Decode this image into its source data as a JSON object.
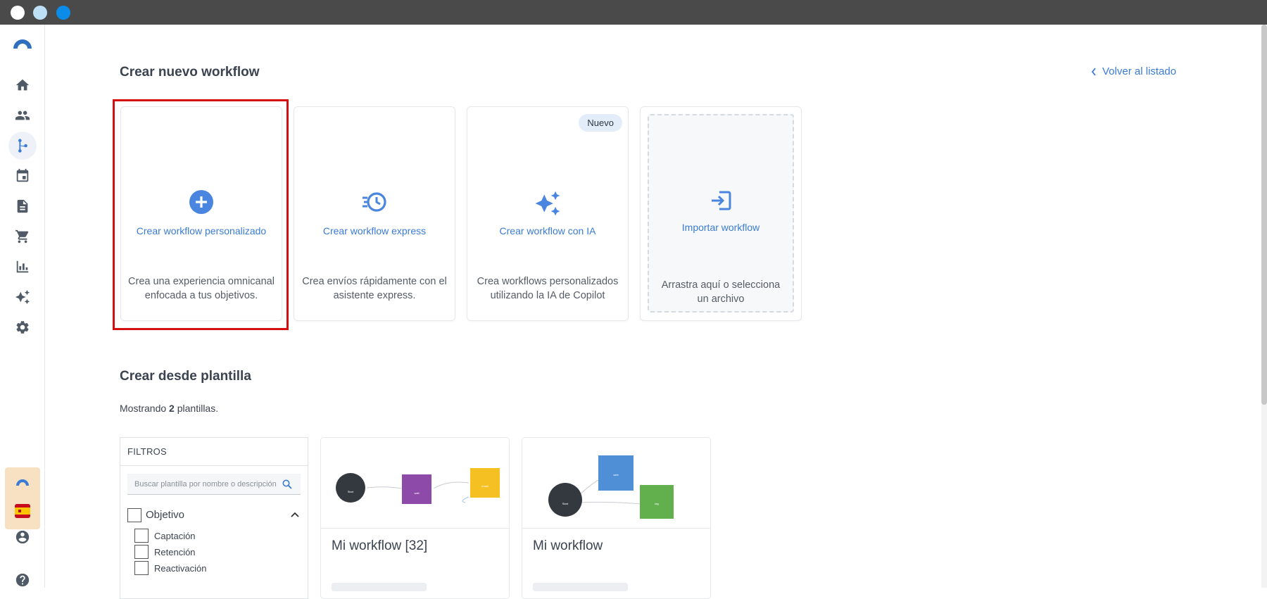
{
  "window": {
    "traffic_light_colors": [
      "#ffffff",
      "#bde0f7",
      "#0a8ce8"
    ]
  },
  "sidebar": {
    "items": [
      {
        "icon": "home-icon"
      },
      {
        "icon": "contacts-icon"
      },
      {
        "icon": "workflow-icon",
        "active": true
      },
      {
        "icon": "calendar-icon"
      },
      {
        "icon": "document-icon"
      },
      {
        "icon": "cart-icon"
      },
      {
        "icon": "chart-icon"
      },
      {
        "icon": "sparkles-icon"
      },
      {
        "icon": "settings-icon"
      }
    ],
    "bottom": [
      "account-icon",
      "help-icon"
    ]
  },
  "header": {
    "title": "Crear nuevo workflow",
    "back_label": "Volver al listado"
  },
  "create_cards": [
    {
      "title": "Crear workflow personalizado",
      "desc": "Crea una experiencia omnicanal enfocada a tus objetivos.",
      "icon": "plus-circle-icon",
      "highlighted": true
    },
    {
      "title": "Crear workflow express",
      "desc": "Crea envíos rápidamente con el asistente express.",
      "icon": "express-clock-icon"
    },
    {
      "title": "Crear workflow con IA",
      "desc": "Crea workflows personalizados utilizando la IA de Copilot",
      "icon": "sparkles-icon",
      "badge": "Nuevo"
    },
    {
      "title": "Importar workflow",
      "desc": "Arrastra aquí o selecciona un archivo",
      "icon": "import-icon"
    }
  ],
  "templates": {
    "title": "Crear desde plantilla",
    "count_prefix": "Mostrando",
    "count": "2",
    "count_suffix": "plantillas.",
    "filters": {
      "title": "FILTROS",
      "search_placeholder": "Buscar plantilla por nombre o descripción",
      "group": "Objetivo",
      "options": [
        "Captación",
        "Retención",
        "Reactivación"
      ]
    },
    "items": [
      {
        "title": "Mi workflow [32]"
      },
      {
        "title": "Mi workflow"
      }
    ]
  },
  "colors": {
    "accent": "#3a7bd5",
    "highlight": "#d30f0f",
    "node_dark": "#34393f",
    "node_purple": "#8e4aa8",
    "node_yellow": "#f4c022",
    "node_blue": "#4f8fd6",
    "node_green": "#62b04d"
  }
}
